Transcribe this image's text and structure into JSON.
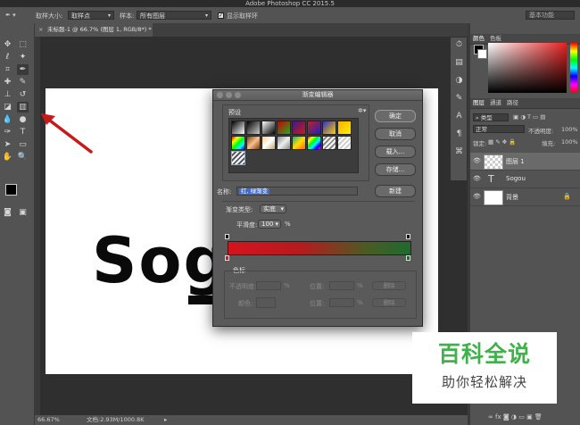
{
  "app": {
    "title": "Adobe Photoshop CC 2015.5"
  },
  "options_bar": {
    "sample_size_label": "取样大小:",
    "sample_size_value": "取样点",
    "sample_label": "样本:",
    "sample_value": "所有图层",
    "show_ring_label": "显示取样环",
    "workspace": "基本功能"
  },
  "document": {
    "tab_title": "未标题-1 @ 66.7% (图层 1, RGB/8*) *",
    "canvas_text": "Sog",
    "zoom": "66.67%",
    "doc_size": "文档:2.93M/1000.8K"
  },
  "color_panel": {
    "tabs": [
      "颜色",
      "色板"
    ],
    "accent_red": "#e52121"
  },
  "layers_panel": {
    "tabs": [
      "图层",
      "通道",
      "路径"
    ],
    "kind_filter": "类型",
    "blend_mode": "正常",
    "opacity_label": "不透明度:",
    "opacity_value": "100%",
    "lock_label": "锁定:",
    "fill_label": "填充:",
    "fill_value": "100%",
    "layers": [
      {
        "name": "图层 1",
        "type": "pixel",
        "selected": true
      },
      {
        "name": "Sogou",
        "type": "text",
        "selected": false
      },
      {
        "name": "背景",
        "type": "background",
        "selected": false
      }
    ]
  },
  "gradient_editor": {
    "title": "渐变编辑器",
    "presets_label": "预设",
    "buttons": {
      "ok": "确定",
      "cancel": "取消",
      "load": "载入...",
      "save": "存储...",
      "new": "新建"
    },
    "name_label": "名称:",
    "name_value": "红, 绿渐变",
    "gradient_type_label": "渐变类型:",
    "gradient_type_value": "实底",
    "smoothness_label": "平滑度:",
    "smoothness_value": "100",
    "smoothness_unit": "%",
    "stops_label": "色标",
    "opacity_label": "不透明度:",
    "location_label": "位置:",
    "delete_label": "删除",
    "color_label": "颜色:",
    "percent": "%",
    "start_color": "#d4141e",
    "end_color": "#1d6b2f"
  },
  "watermark": {
    "big": "百科全说",
    "small": "助你轻松解决"
  }
}
